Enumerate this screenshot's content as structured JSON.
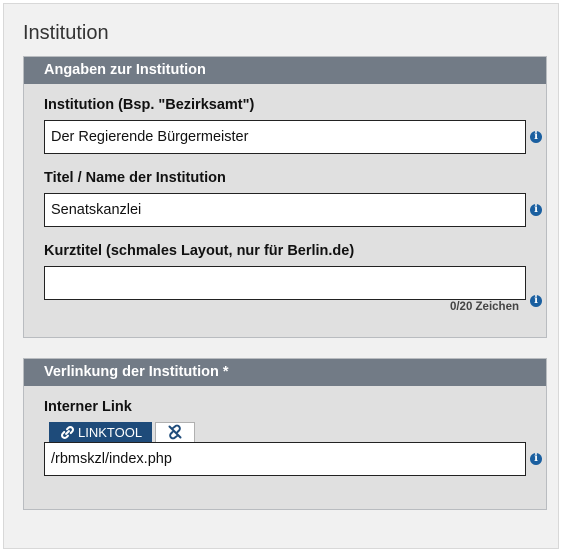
{
  "page": {
    "title": "Institution"
  },
  "institution_panel": {
    "header": "Angaben zur Institution",
    "institution_field": {
      "label": "Institution (Bsp. \"Bezirksamt\")",
      "value": "Der Regierende Bürgermeister"
    },
    "titel_field": {
      "label": "Titel / Name der Institution",
      "value": "Senatskanzlei"
    },
    "kurztitel_field": {
      "label": "Kurztitel (schmales Layout, nur für Berlin.de)",
      "value": "",
      "counter": "0/20 Zeichen"
    },
    "info_icon": "i"
  },
  "link_panel": {
    "header": "Verlinkung der Institution *",
    "interner_link": {
      "label": "Interner Link",
      "linktool_label": "LINKTOOL",
      "value": "/rbmskzl/index.php"
    },
    "info_icon": "i"
  },
  "icons": {
    "info": "info-icon",
    "link": "link-icon",
    "unlink": "unlink-icon"
  },
  "colors": {
    "panel_header": "#727b86",
    "panel_body": "#e0e0e0",
    "linktool_button": "#1e4b7a",
    "info_icon": "#1a5fa0"
  }
}
